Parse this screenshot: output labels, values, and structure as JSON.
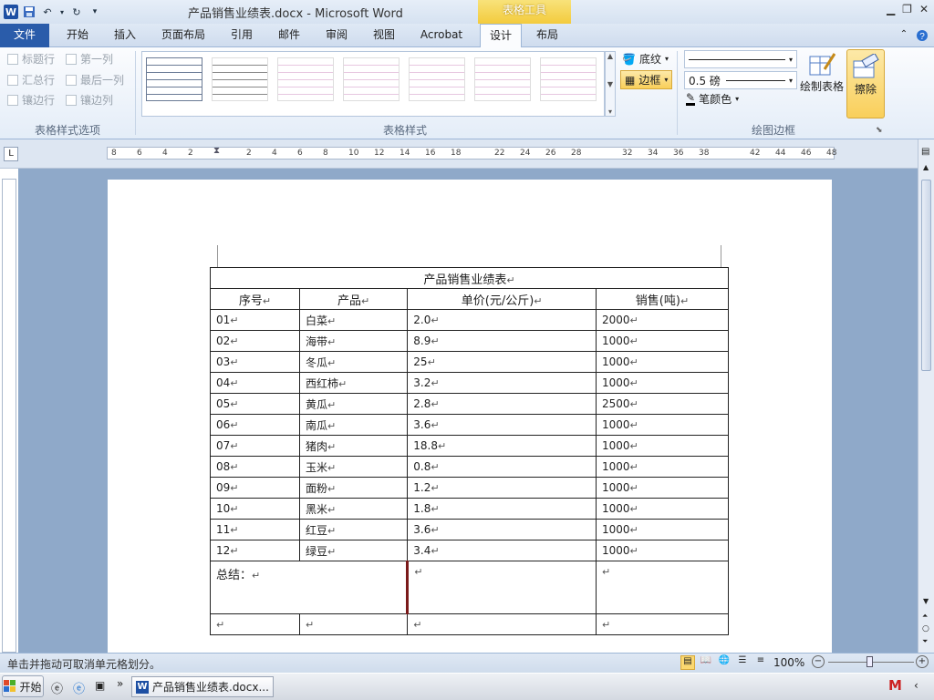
{
  "window": {
    "title": "产品销售业绩表.docx - Microsoft Word",
    "tool_context": "表格工具",
    "app_icon": "W"
  },
  "tabs": [
    "文件",
    "开始",
    "插入",
    "页面布局",
    "引用",
    "邮件",
    "审阅",
    "视图",
    "Acrobat",
    "设计",
    "布局"
  ],
  "active_tab": "设计",
  "ribbon": {
    "table_style_options": {
      "label": "表格样式选项",
      "items": [
        "标题行",
        "第一列",
        "汇总行",
        "最后一列",
        "镶边行",
        "镶边列"
      ]
    },
    "table_styles": {
      "label": "表格样式",
      "shading": "底纹",
      "borders": "边框"
    },
    "draw_borders": {
      "label": "绘图边框",
      "pen_weight": "0.5 磅",
      "pen_color": "笔颜色",
      "draw_table": "绘制表格",
      "eraser": "擦除"
    }
  },
  "ruler": {
    "labels": [
      "8",
      "6",
      "4",
      "2",
      "2",
      "4",
      "6",
      "8",
      "10",
      "12",
      "14",
      "16",
      "18",
      "22",
      "24",
      "26",
      "28",
      "32",
      "34",
      "36",
      "38",
      "42",
      "44",
      "46",
      "48"
    ]
  },
  "table": {
    "title": "产品销售业绩表",
    "headers": [
      "序号",
      "产品",
      "单价(元/公斤)",
      "销售(吨)"
    ],
    "rows": [
      [
        "01",
        "白菜",
        "2.0",
        "2000"
      ],
      [
        "02",
        "海带",
        "8.9",
        "1000"
      ],
      [
        "03",
        "冬瓜",
        "25",
        "1000"
      ],
      [
        "04",
        "西红柿",
        "3.2",
        "1000"
      ],
      [
        "05",
        "黄瓜",
        "2.8",
        "2500"
      ],
      [
        "06",
        "南瓜",
        "3.6",
        "1000"
      ],
      [
        "07",
        "猪肉",
        "18.8",
        "1000"
      ],
      [
        "08",
        "玉米",
        "0.8",
        "1000"
      ],
      [
        "09",
        "面粉",
        "1.2",
        "1000"
      ],
      [
        "10",
        "黑米",
        "1.8",
        "1000"
      ],
      [
        "11",
        "红豆",
        "3.6",
        "1000"
      ],
      [
        "12",
        "绿豆",
        "3.4",
        "1000"
      ]
    ],
    "summary_label": "总结："
  },
  "paragraph_mark": "↵",
  "status": {
    "message": "单击并拖动可取消单元格划分。",
    "zoom": "100%"
  },
  "taskbar": {
    "start": "开始",
    "item": "产品销售业绩表.docx..."
  }
}
